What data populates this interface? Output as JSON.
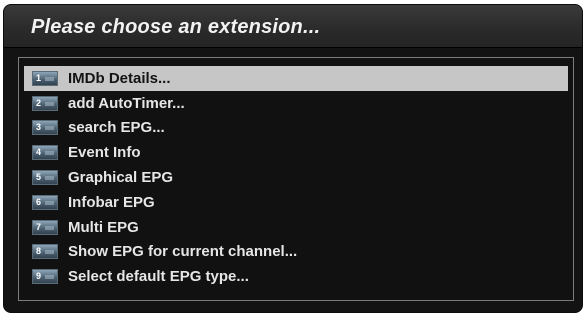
{
  "dialog": {
    "title": "Please choose an extension..."
  },
  "menu": {
    "selected_index": 0,
    "items": [
      {
        "key": "1",
        "label": "IMDb Details..."
      },
      {
        "key": "2",
        "label": "add AutoTimer..."
      },
      {
        "key": "3",
        "label": "search EPG..."
      },
      {
        "key": "4",
        "label": "Event Info"
      },
      {
        "key": "5",
        "label": "Graphical EPG"
      },
      {
        "key": "6",
        "label": "Infobar EPG"
      },
      {
        "key": "7",
        "label": "Multi EPG"
      },
      {
        "key": "8",
        "label": "Show EPG for current channel..."
      },
      {
        "key": "9",
        "label": "Select default EPG type..."
      }
    ]
  },
  "colors": {
    "background": "#131313",
    "selection": "#c6c6c6",
    "text": "#e6e6e6"
  }
}
